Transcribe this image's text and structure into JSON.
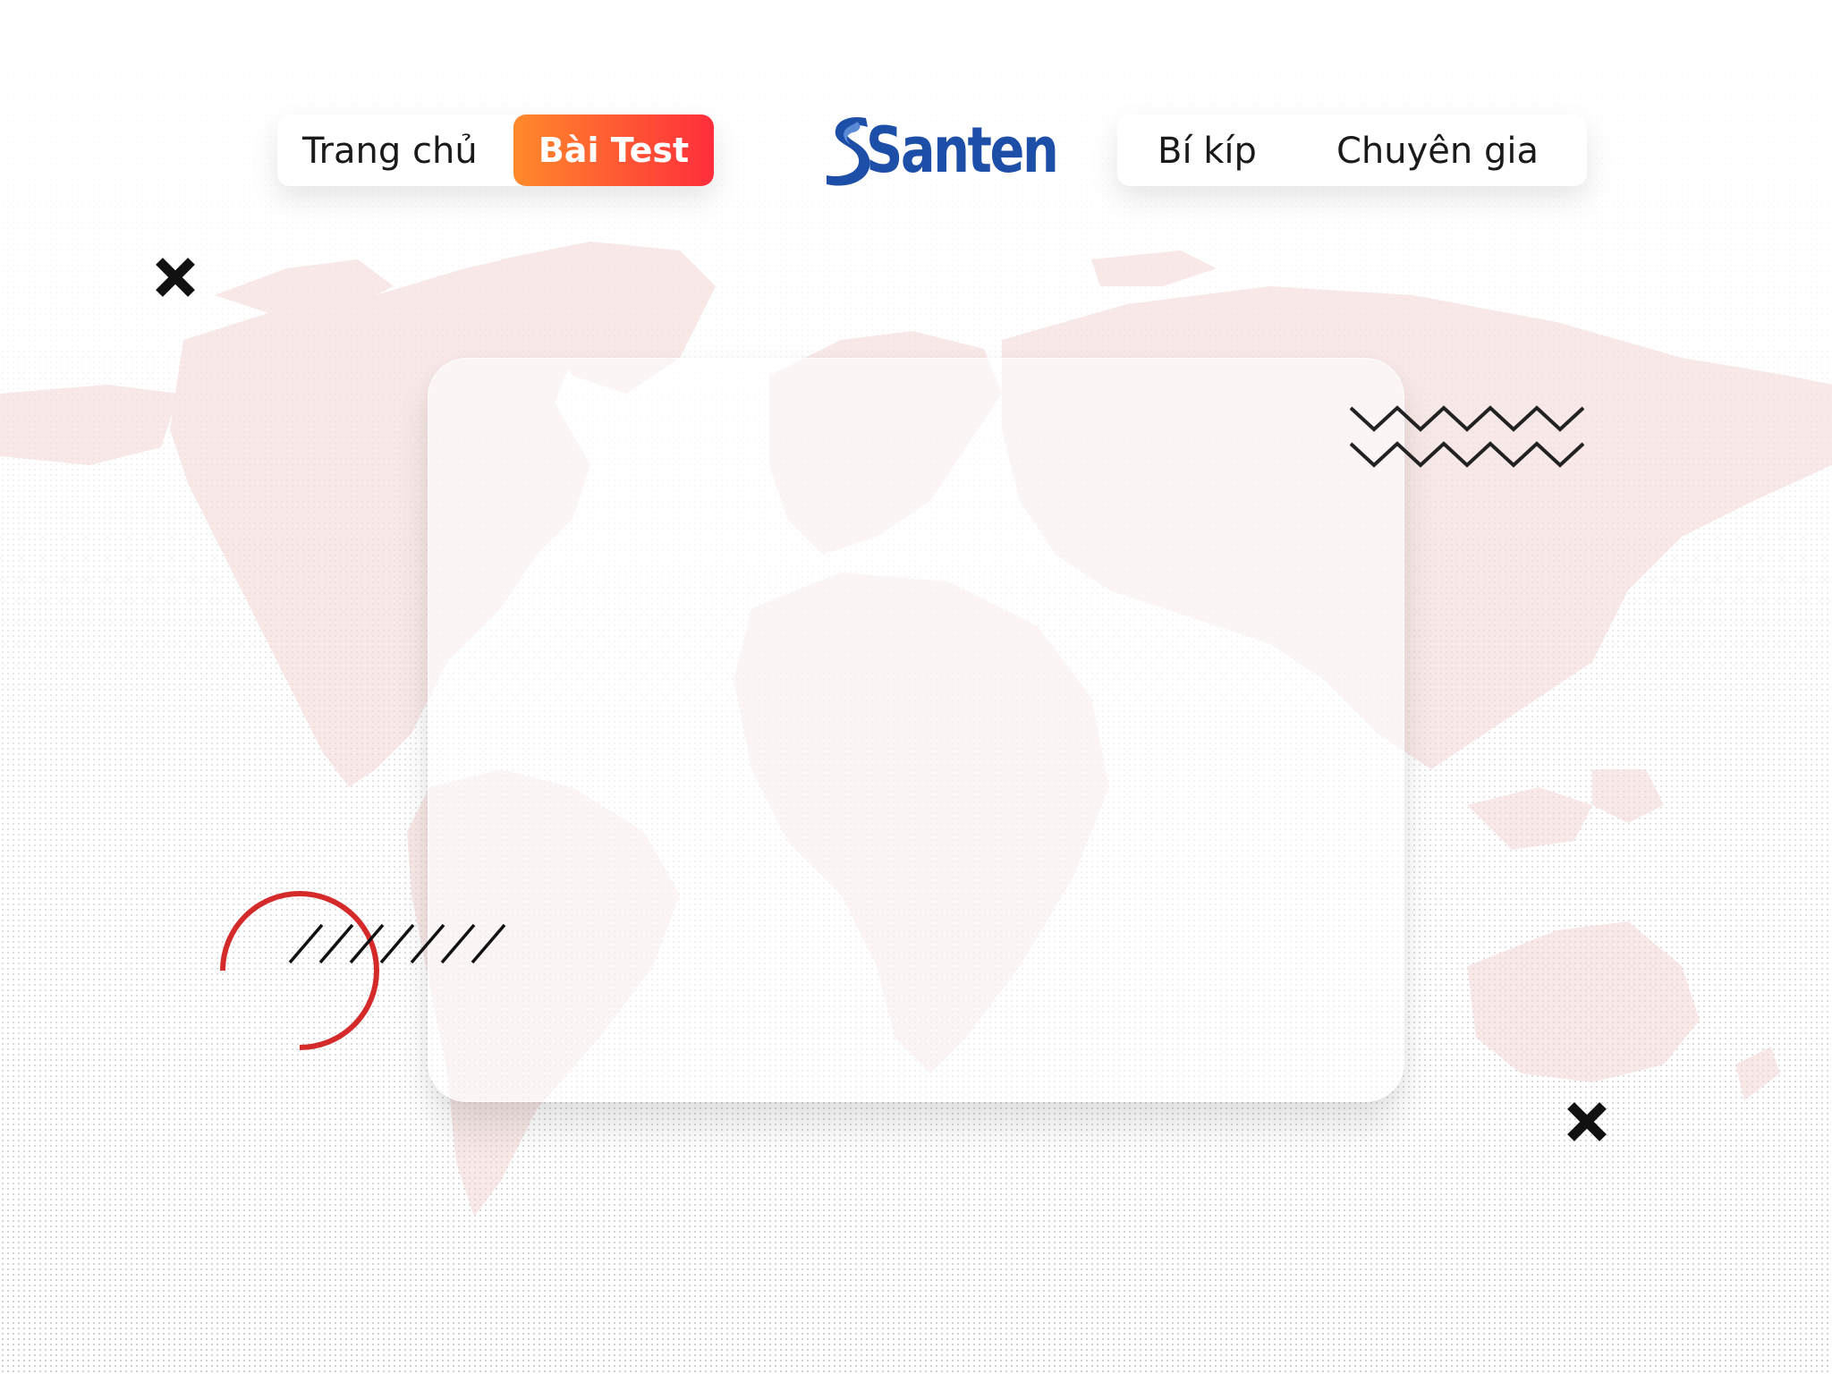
{
  "nav": {
    "left": {
      "home_label": "Trang chủ",
      "test_label": "Bài Test"
    },
    "logo_text": "Santen",
    "right": {
      "tips_label": "Bí kíp",
      "expert_label": "Chuyên gia"
    }
  },
  "colors": {
    "cta_gradient_start": "#ff8a2a",
    "cta_gradient_end": "#ff2d3c",
    "logo_blue": "#1d4fa8",
    "map_tint": "#f5dede",
    "accent_red": "#d42a2a"
  },
  "decorations": {
    "icons": [
      "close-x-icon",
      "zigzag-lines",
      "red-arc",
      "diagonal-hatch",
      "world-map"
    ]
  }
}
